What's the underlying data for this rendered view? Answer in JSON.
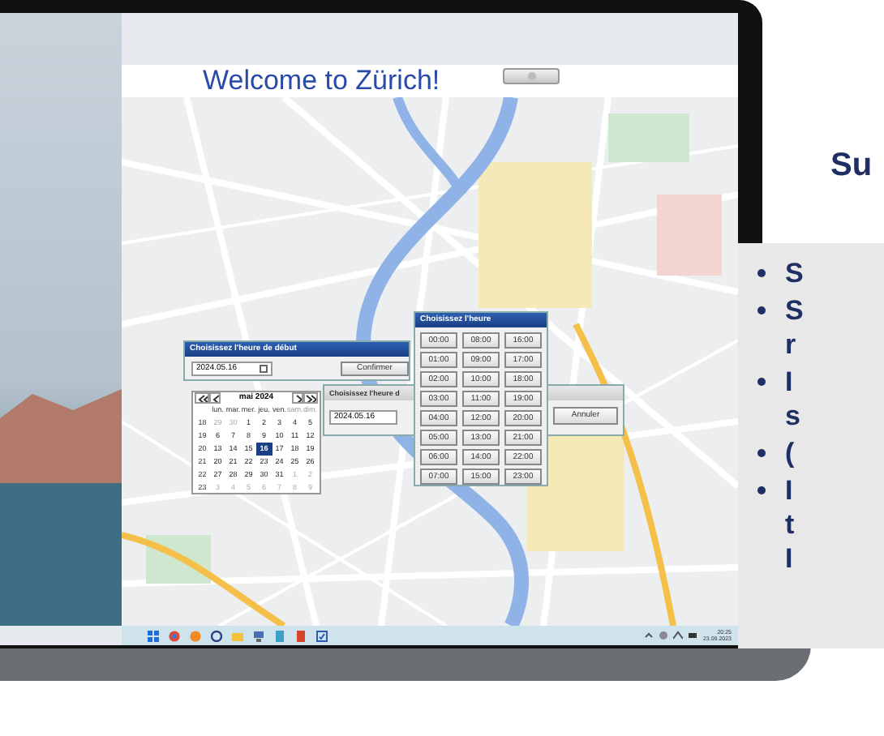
{
  "app": {
    "title": "Welcome to Zürich!"
  },
  "start_dialog": {
    "title": "Choisissez l'heure de début",
    "date": "2024.05.16",
    "confirm": "Confirmer",
    "calendar": {
      "month": "mai 2024",
      "weekdays": [
        "lun.",
        "mar.",
        "mer.",
        "jeu.",
        "ven.",
        "sam.",
        "dim."
      ],
      "weeks": [
        {
          "number": "18",
          "days": [
            {
              "day": "29",
              "outside": true,
              "selected": false
            },
            {
              "day": "30",
              "outside": true,
              "selected": false
            },
            {
              "day": "1",
              "outside": false,
              "selected": false
            },
            {
              "day": "2",
              "outside": false,
              "selected": false
            },
            {
              "day": "3",
              "outside": false,
              "selected": false
            },
            {
              "day": "4",
              "outside": false,
              "selected": false
            },
            {
              "day": "5",
              "outside": false,
              "selected": false
            }
          ]
        },
        {
          "number": "19",
          "days": [
            {
              "day": "6",
              "outside": false,
              "selected": false
            },
            {
              "day": "7",
              "outside": false,
              "selected": false
            },
            {
              "day": "8",
              "outside": false,
              "selected": false
            },
            {
              "day": "9",
              "outside": false,
              "selected": false
            },
            {
              "day": "10",
              "outside": false,
              "selected": false
            },
            {
              "day": "11",
              "outside": false,
              "selected": false
            },
            {
              "day": "12",
              "outside": false,
              "selected": false
            }
          ]
        },
        {
          "number": "20",
          "days": [
            {
              "day": "13",
              "outside": false,
              "selected": false
            },
            {
              "day": "14",
              "outside": false,
              "selected": false
            },
            {
              "day": "15",
              "outside": false,
              "selected": false
            },
            {
              "day": "16",
              "outside": false,
              "selected": true
            },
            {
              "day": "17",
              "outside": false,
              "selected": false
            },
            {
              "day": "18",
              "outside": false,
              "selected": false
            },
            {
              "day": "19",
              "outside": false,
              "selected": false
            }
          ]
        },
        {
          "number": "21",
          "days": [
            {
              "day": "20",
              "outside": false,
              "selected": false
            },
            {
              "day": "21",
              "outside": false,
              "selected": false
            },
            {
              "day": "22",
              "outside": false,
              "selected": false
            },
            {
              "day": "23",
              "outside": false,
              "selected": false
            },
            {
              "day": "24",
              "outside": false,
              "selected": false
            },
            {
              "day": "25",
              "outside": false,
              "selected": false
            },
            {
              "day": "26",
              "outside": false,
              "selected": false
            }
          ]
        },
        {
          "number": "22",
          "days": [
            {
              "day": "27",
              "outside": false,
              "selected": false
            },
            {
              "day": "28",
              "outside": false,
              "selected": false
            },
            {
              "day": "29",
              "outside": false,
              "selected": false
            },
            {
              "day": "30",
              "outside": false,
              "selected": false
            },
            {
              "day": "31",
              "outside": false,
              "selected": false
            },
            {
              "day": "1",
              "outside": true,
              "selected": false
            },
            {
              "day": "2",
              "outside": true,
              "selected": false
            }
          ]
        },
        {
          "number": "23",
          "days": [
            {
              "day": "3",
              "outside": true,
              "selected": false
            },
            {
              "day": "4",
              "outside": true,
              "selected": false
            },
            {
              "day": "5",
              "outside": true,
              "selected": false
            },
            {
              "day": "6",
              "outside": true,
              "selected": false
            },
            {
              "day": "7",
              "outside": true,
              "selected": false
            },
            {
              "day": "8",
              "outside": true,
              "selected": false
            },
            {
              "day": "9",
              "outside": true,
              "selected": false
            }
          ]
        }
      ]
    }
  },
  "end_dialog": {
    "title": "Choisissez l'heure d",
    "date": "2024.05.16",
    "cancel": "Annuler"
  },
  "time_dialog": {
    "title": "Choisissez l'heure",
    "times": [
      "00:00",
      "01:00",
      "02:00",
      "03:00",
      "04:00",
      "05:00",
      "06:00",
      "07:00",
      "08:00",
      "09:00",
      "10:00",
      "11:00",
      "12:00",
      "13:00",
      "14:00",
      "15:00",
      "16:00",
      "17:00",
      "18:00",
      "19:00",
      "20:00",
      "21:00",
      "22:00",
      "23:00"
    ]
  },
  "taskbar": {
    "time": "20:25",
    "date": "23.09.2023"
  },
  "slide": {
    "title": "Su",
    "bullets": [
      {
        "lines": [
          "S"
        ]
      },
      {
        "lines": [
          "S",
          "r"
        ]
      },
      {
        "lines": [
          "I",
          "s"
        ]
      },
      {
        "lines": [
          "("
        ]
      },
      {
        "lines": [
          "I",
          "t",
          "I"
        ]
      }
    ]
  }
}
